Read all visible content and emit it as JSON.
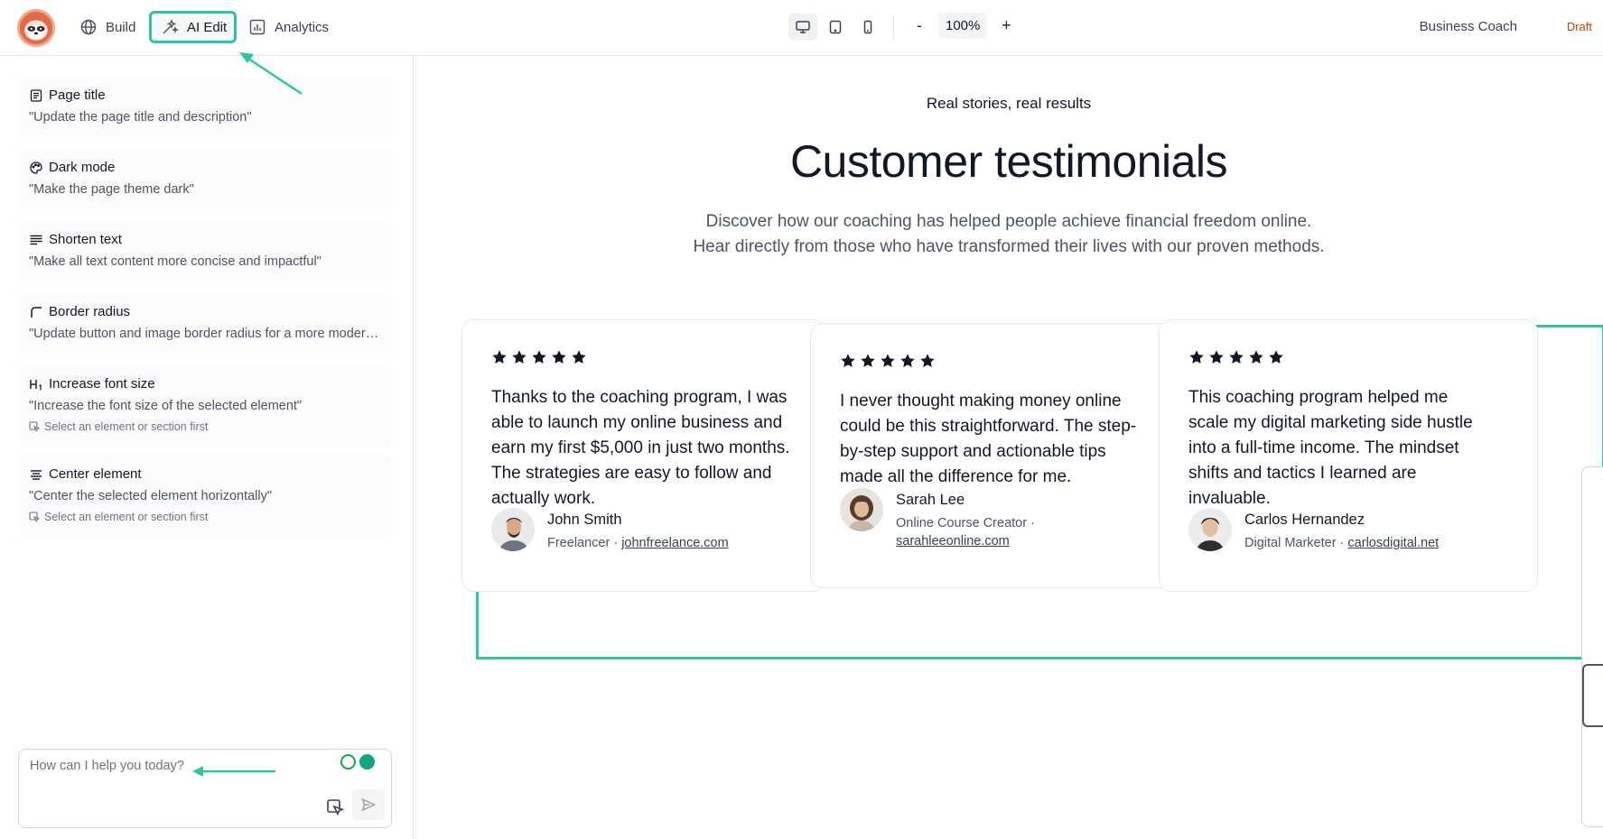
{
  "nav": {
    "build_label": "Build",
    "ai_edit_label": "AI Edit",
    "analytics_label": "Analytics"
  },
  "zoom": {
    "minus": "-",
    "value": "100%",
    "plus": "+"
  },
  "project": {
    "name": "Business Coach",
    "status": "Draft"
  },
  "suggestions": [
    {
      "title": "Page title",
      "desc": "\"Update the page title and description\"",
      "hint": ""
    },
    {
      "title": "Dark mode",
      "desc": "\"Make the page theme dark\"",
      "hint": ""
    },
    {
      "title": "Shorten text",
      "desc": "\"Make all text content more concise and impactful\"",
      "hint": ""
    },
    {
      "title": "Border radius",
      "desc": "\"Update button and image border radius for a more modern look\"",
      "hint": ""
    },
    {
      "title": "Increase font size",
      "desc": "\"Increase the font size of the selected element\"",
      "hint": "Select an element or section first"
    },
    {
      "title": "Center element",
      "desc": "\"Center the selected element horizontally\"",
      "hint": "Select an element or section first"
    }
  ],
  "chat": {
    "placeholder": "How can I help you today?"
  },
  "section": {
    "eyebrow": "Real stories, real results",
    "title": "Customer testimonials",
    "subtitle_line1": "Discover how our coaching has helped people achieve financial freedom online.",
    "subtitle_line2": "Hear directly from those who have transformed their lives with our proven methods."
  },
  "testimonials": [
    {
      "rating": 5,
      "quote": "Thanks to the coaching program, I was able to launch my online business and earn my first $5,000 in just two months. The strategies are easy to follow and actually work.",
      "name": "John Smith",
      "role": "Freelancer · ",
      "link": "johnfreelance.com"
    },
    {
      "rating": 5,
      "quote": "I never thought making money online could be this straightforward. The step-by-step support and actionable tips made all the difference for me.",
      "name": "Sarah Lee",
      "role": "Online Course Creator · ",
      "link": "sarahleeonline.com"
    },
    {
      "rating": 5,
      "quote": "This coaching program helped me scale my digital marketing side hustle into a full-time income. The mindset shifts and tactics I learned are invaluable.",
      "name": "Carlos Hernandez",
      "role": "Digital Marketer · ",
      "link": "carlosdigital.net"
    }
  ],
  "colors": {
    "accent": "#2ec4a2",
    "draft": "#c2410c",
    "brand": "#e06a4a"
  },
  "icons": {
    "logo": "sloth-logo-icon",
    "build": "globe-icon",
    "ai_edit": "sparkles-icon",
    "analytics": "bar-chart-icon",
    "devices": [
      "desktop-icon",
      "tablet-icon",
      "mobile-icon"
    ],
    "suggestions": [
      "document-icon",
      "palette-icon",
      "align-lines-icon",
      "corner-radius-icon",
      "heading-icon",
      "center-align-icon"
    ],
    "send": "send-icon",
    "select": "cursor-select-icon"
  }
}
